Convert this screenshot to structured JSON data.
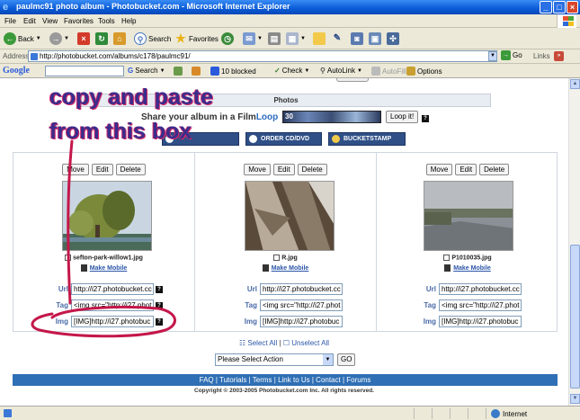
{
  "window": {
    "title": "paulmc91 photo album - Photobucket.com - Microsoft Internet Explorer"
  },
  "menu": [
    "File",
    "Edit",
    "View",
    "Favorites",
    "Tools",
    "Help"
  ],
  "toolbar": {
    "back": "Back",
    "search": "Search",
    "favorites": "Favorites"
  },
  "address": {
    "label": "Address",
    "url": "http://photobucket.com/albums/c178/paulmc91/",
    "go": "Go",
    "links": "Links"
  },
  "google": {
    "logo": "Google",
    "search": "Search",
    "blocked": "10 blocked",
    "check": "Check",
    "autolink": "AutoLink",
    "autofill": "AutoFill",
    "options": "Options"
  },
  "page": {
    "photos_heading": "Photos",
    "share_prefix": "Share your album in a Film",
    "share_link": "Loop",
    "filmstrip_badge": "30",
    "loop_button": "Loop it!",
    "help": "?",
    "order_cd": "ORDER CD/DVD",
    "bucketstamp": "BUCKETSTAMP",
    "annotation_line1": "copy and paste",
    "annotation_line2": "from this box",
    "cell_buttons": {
      "move": "Move",
      "edit": "Edit",
      "delete": "Delete"
    },
    "labels": {
      "url": "Url",
      "tag": "Tag",
      "img": "Img"
    },
    "photos": [
      {
        "filename": "sefton-park-willow1.jpg",
        "mobile": "Make Mobile",
        "url": "http://i27.photobucket.cc",
        "tag": "<img src=\"http://i27.phot",
        "img": "[IMG]http://i27.photobuc"
      },
      {
        "filename": "R.jpg",
        "mobile": "Make Mobile",
        "url": "http://i27.photobucket.cc",
        "tag": "<img src=\"http://i27.phot",
        "img": "[IMG]http://i27.photobuc"
      },
      {
        "filename": "P1010035.jpg",
        "mobile": "Make Mobile",
        "url": "http://i27.photobucket.cc",
        "tag": "<img src=\"http://i27.phot",
        "img": "[IMG]http://i27.photobuc"
      }
    ],
    "select_all": "Select All",
    "separator": "|",
    "unselect_all": "Unselect All",
    "action_select": "Please Select Action",
    "go": "GO",
    "footer": "FAQ | Tutorials | Terms | Link to Us | Contact | Forums",
    "copyright": "Copyright © 2003-2005 Photobucket.com Inc. All rights reserved."
  },
  "status": {
    "zone": "Internet"
  },
  "colors": {
    "annotation_ink": "#3a2d8c",
    "annotation_highlight": "#d42a6a",
    "footer_bar": "#2f6fb5",
    "photobucket_blue": "#2f4f86"
  }
}
